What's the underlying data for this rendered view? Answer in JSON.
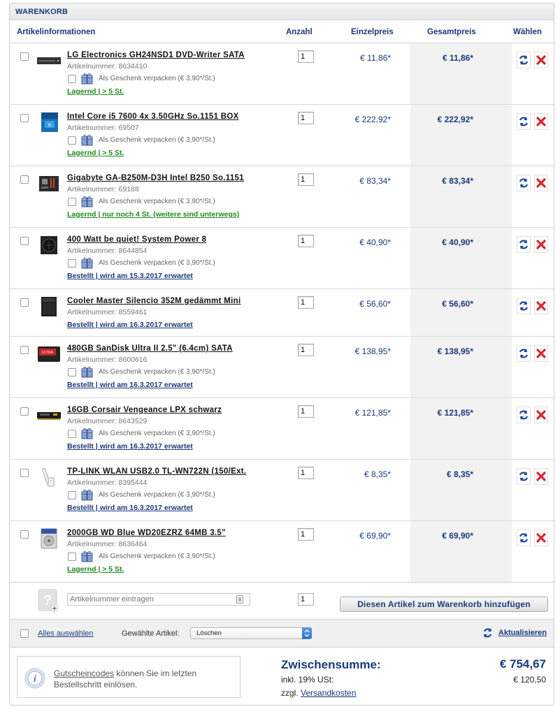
{
  "cart": {
    "title": "WARENKORB",
    "columns": {
      "info": "Artikelinformationen",
      "qty": "Anzahl",
      "unit": "Einzelpreis",
      "total": "Gesamtpreis",
      "choose": "Wählen"
    },
    "gift_label": "Als Geschenk verpacken (€ 3,90*/St.)",
    "items": [
      {
        "name": "LG Electronics GH24NSD1 DVD-Writer SATA",
        "artnr": "Artikelnummer: 8634410",
        "gift": true,
        "stock": "Lagernd | > 5 St.",
        "stock_color": "#1f8a1f",
        "qty": "1",
        "unit_price": "€ 11,86*",
        "total_price": "€ 11,86*",
        "thumb": "dvd-drive-icon"
      },
      {
        "name": "Intel Core i5 7600 4x 3.50GHz So.1151 BOX",
        "artnr": "Artikelnummer: 69507",
        "gift": true,
        "stock": "Lagernd | > 5 St.",
        "stock_color": "#1f8a1f",
        "qty": "1",
        "unit_price": "€ 222,92*",
        "total_price": "€ 222,92*",
        "thumb": "cpu-box-icon"
      },
      {
        "name": "Gigabyte GA-B250M-D3H Intel B250 So.1151",
        "artnr": "Artikelnummer: 69188",
        "gift": true,
        "stock": "Lagernd | nur noch 4 St. (weitere sind unterwegs)",
        "stock_color": "#1f8a1f",
        "qty": "1",
        "unit_price": "€ 83,34*",
        "total_price": "€ 83,34*",
        "thumb": "motherboard-icon"
      },
      {
        "name": "400 Watt be quiet! System Power 8",
        "artnr": "Artikelnummer: 8644854",
        "gift": true,
        "stock": "Bestellt | wird am 15.3.2017 erwartet",
        "stock_color": "#1a3a7a",
        "qty": "1",
        "unit_price": "€ 40,90*",
        "total_price": "€ 40,90*",
        "thumb": "power-supply-icon"
      },
      {
        "name": "Cooler Master Silencio 352M gedämmt Mini",
        "artnr": "Artikelnummer: 8559461",
        "gift": false,
        "stock": "Bestellt | wird am 16.3.2017 erwartet",
        "stock_color": "#1a3a7a",
        "qty": "1",
        "unit_price": "€ 56,60*",
        "total_price": "€ 56,60*",
        "thumb": "pc-case-icon"
      },
      {
        "name": "480GB SanDisk Ultra II 2.5\" (6.4cm) SATA",
        "artnr": "Artikelnummer: 8600616",
        "gift": true,
        "stock": "Bestellt | wird am 16.3.2017 erwartet",
        "stock_color": "#1a3a7a",
        "qty": "1",
        "unit_price": "€ 138,95*",
        "total_price": "€ 138,95*",
        "thumb": "ssd-icon"
      },
      {
        "name": "16GB Corsair Vengeance LPX schwarz",
        "artnr": "Artikelnummer: 8643529",
        "gift": true,
        "stock": "Bestellt | wird am 16.3.2017 erwartet",
        "stock_color": "#1a3a7a",
        "qty": "1",
        "unit_price": "€ 121,85*",
        "total_price": "€ 121,85*",
        "thumb": "ram-icon"
      },
      {
        "name": "TP-LINK WLAN USB2.0 TL-WN722N (150/Ext.",
        "artnr": "Artikelnummer: 8395444",
        "gift": true,
        "stock": "Bestellt | wird am 16.3.2017 erwartet",
        "stock_color": "#1a3a7a",
        "qty": "1",
        "unit_price": "€ 8,35*",
        "total_price": "€ 8,35*",
        "thumb": "wifi-adapter-icon"
      },
      {
        "name": "2000GB WD Blue WD20EZRZ 64MB 3.5\"",
        "artnr": "Artikelnummer: 8636464",
        "gift": true,
        "stock": "Lagernd | > 5 St.",
        "stock_color": "#1f8a1f",
        "qty": "1",
        "unit_price": "€ 69,90*",
        "total_price": "€ 69,90*",
        "thumb": "hdd-icon"
      }
    ],
    "add": {
      "placeholder": "Artikelnummer eintragen",
      "qty": "1",
      "button": "Diesen Artikel zum Warenkorb hinzufügen"
    },
    "bulk": {
      "select_all": "Alles auswählen",
      "chosen_label": "Gewählte Artikel:",
      "action": "Löschen",
      "update": "Aktualisieren"
    },
    "footer": {
      "voucher_link": "Gutscheincodes",
      "voucher_rest": " können Sie im letzten Bestellschritt einlösen.",
      "subtotal_label": "Zwischensumme:",
      "subtotal_value": "€ 754,67",
      "vat_label": "inkl. 19% USt:",
      "vat_value": "€ 120,50",
      "ship_prefix": "zzgl. ",
      "ship_link": "Versandkosten"
    },
    "colors": {
      "brand": "#1a3a7a",
      "in_stock": "#1f8a1f",
      "delete": "#d9262c"
    }
  }
}
